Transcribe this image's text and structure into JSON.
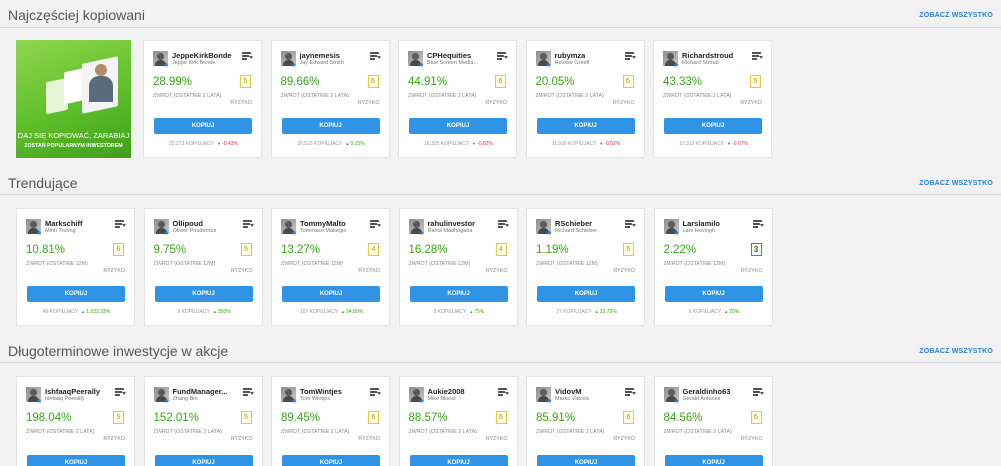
{
  "sections": [
    {
      "title": "Najczęściej kopiowani",
      "see_all": "ZOBACZ WSZYSTKO",
      "promo": {
        "line1": "DAJ SIĘ KOPIOWAĆ, ZARABIAJ",
        "line2": "ZOSTAŃ POPULARNYM INWESTOREM"
      },
      "cards": [
        {
          "username": "JeppeKirkBonde",
          "name": "Jeppe Kirk Bonde",
          "gain": "28.99%",
          "risk": "5",
          "return_label": "ZWROT (OSTATNIE 2 LATA)",
          "risk_label": "RYZYKO",
          "button": "KOPIUJ",
          "copiers": "22,273 KOPIUJĄCY",
          "change": "-0.43%",
          "dir": "down"
        },
        {
          "username": "jaynemesis",
          "name": "Jay Edward Smith",
          "gain": "89.66%",
          "risk": "6",
          "return_label": "ZWROT (OSTATNIE 2 LATA)",
          "risk_label": "RYZYKO",
          "button": "KOPIUJ",
          "copiers": "20,523 KOPIUJĄCY",
          "change": "0.15%",
          "dir": "up"
        },
        {
          "username": "CPHequities",
          "name": "Blue Screen Media...",
          "gain": "44.91%",
          "risk": "6",
          "return_label": "ZWROT (OSTATNIE 2 LATA)",
          "risk_label": "RYZYKO",
          "button": "KOPIUJ",
          "copiers": "16,325 KOPIUJĄCY",
          "change": "-0.82%",
          "dir": "down"
        },
        {
          "username": "rubymza",
          "name": "Heloise Greeff",
          "gain": "20.05%",
          "risk": "6",
          "return_label": "ZWROT (OSTATNIE 2 LATA)",
          "risk_label": "RYZYKO",
          "button": "KOPIUJ",
          "copiers": "11,506 KOPIUJĄCY",
          "change": "-0.52%",
          "dir": "down"
        },
        {
          "username": "Richardstroud",
          "name": "Richard Stroud",
          "gain": "43.33%",
          "risk": "5",
          "return_label": "ZWROT (OSTATNIE 2 LATA)",
          "risk_label": "RYZYKO",
          "button": "KOPIUJ",
          "copiers": "10,312 KOPIUJĄCY",
          "change": "-0.67%",
          "dir": "down"
        }
      ]
    },
    {
      "title": "Trendujące",
      "see_all": "ZOBACZ WSZYSTKO",
      "cards": [
        {
          "username": "Markschiff",
          "name": "Minh Truong",
          "gain": "10.81%",
          "risk": "6",
          "return_label": "ZWROT (OSTATNIE 12M)",
          "risk_label": "RYZYKO",
          "button": "KOPIUJ",
          "copiers": "49 KOPIUJĄCY",
          "change": "1,533.33%",
          "dir": "up"
        },
        {
          "username": "Ollipoud",
          "name": "Olivier Poudernux",
          "gain": "9.75%",
          "risk": "5",
          "return_label": "ZWROT (OSTATNIE 12M)",
          "risk_label": "RYZYKO",
          "button": "KOPIUJ",
          "copiers": "9 KOPIUJĄCY",
          "change": "350%",
          "dir": "up"
        },
        {
          "username": "TommyMalto",
          "name": "Tommaso Malorgio",
          "gain": "13.27%",
          "risk": "4",
          "return_label": "ZWROT (OSTATNIE 12M)",
          "risk_label": "RYZYKO",
          "button": "KOPIUJ",
          "copiers": "107 KOPIUJĄCY",
          "change": "34.89%",
          "dir": "up"
        },
        {
          "username": "rahulinvestor",
          "name": "Rahul Madhogaria",
          "gain": "16.28%",
          "risk": "4",
          "return_label": "ZWROT (OSTATNIE 12M)",
          "risk_label": "RYZYKO",
          "button": "KOPIUJ",
          "copiers": "5 KOPIUJĄCY",
          "change": "75%",
          "dir": "up"
        },
        {
          "username": "RSchieber",
          "name": "Richard Schieber",
          "gain": "1.19%",
          "risk": "5",
          "return_label": "ZWROT (OSTATNIE 12M)",
          "risk_label": "RYZYKO",
          "button": "KOPIUJ",
          "copiers": "27 KOPIUJĄCY",
          "change": "33.73%",
          "dir": "up"
        },
        {
          "username": "Larslamilo",
          "name": "Lars Hovingh",
          "gain": "2.22%",
          "risk": "3",
          "risk_style": "green",
          "return_label": "ZWROT (OSTATNIE 12M)",
          "risk_label": "RYZYKO",
          "button": "KOPIUJ",
          "copiers": "6 KOPIUJĄCY",
          "change": "20%",
          "dir": "up"
        }
      ]
    },
    {
      "title": "Długoterminowe inwestycje w akcje",
      "see_all": "ZOBACZ WSZYSTKO",
      "cards": [
        {
          "username": "IshfaaqPeerally",
          "name": "Ishfaaq Peerally",
          "gain": "198.04%",
          "risk": "5",
          "return_label": "ZWROT (OSTATNIE 2 LATA)",
          "risk_label": "RYZYKO",
          "button": "KOPIUJ"
        },
        {
          "username": "FundManager...",
          "name": "Zhang Bin",
          "gain": "152.01%",
          "risk": "5",
          "return_label": "ZWROT (OSTATNIE 2 LATA)",
          "risk_label": "RYZYKO",
          "button": "KOPIUJ"
        },
        {
          "username": "TomWintjes",
          "name": "Tom Wintjes",
          "gain": "89.45%",
          "risk": "6",
          "return_label": "ZWROT (OSTATNIE 2 LATA)",
          "risk_label": "RYZYKO",
          "button": "KOPIUJ"
        },
        {
          "username": "Aukie2008",
          "name": "Mike Moest",
          "gain": "88.57%",
          "risk": "6",
          "return_label": "ZWROT (OSTATNIE 2 LATA)",
          "risk_label": "RYZYKO",
          "button": "KOPIUJ"
        },
        {
          "username": "VidovM",
          "name": "Marko Vidovic",
          "gain": "85.91%",
          "risk": "6",
          "return_label": "ZWROT (OSTATNIE 2 LATA)",
          "risk_label": "RYZYKO",
          "button": "KOPIUJ"
        },
        {
          "username": "Geraldinho63",
          "name": "Gerald Antunes",
          "gain": "84.56%",
          "risk": "6",
          "return_label": "ZWROT (OSTATNIE 2 LATA)",
          "risk_label": "RYZYKO",
          "button": "KOPIUJ"
        }
      ]
    }
  ],
  "colors": {
    "accent": "#2f94e6",
    "gain": "#3aa51b",
    "loss": "#e0314b",
    "risk_border": "#e6c84a",
    "link": "#2b7fd8"
  },
  "icons": {
    "card_menu": "list-filter-icon",
    "verified": "star-icon",
    "arrow_up": "triangle-up-icon",
    "arrow_down": "triangle-down-icon"
  }
}
